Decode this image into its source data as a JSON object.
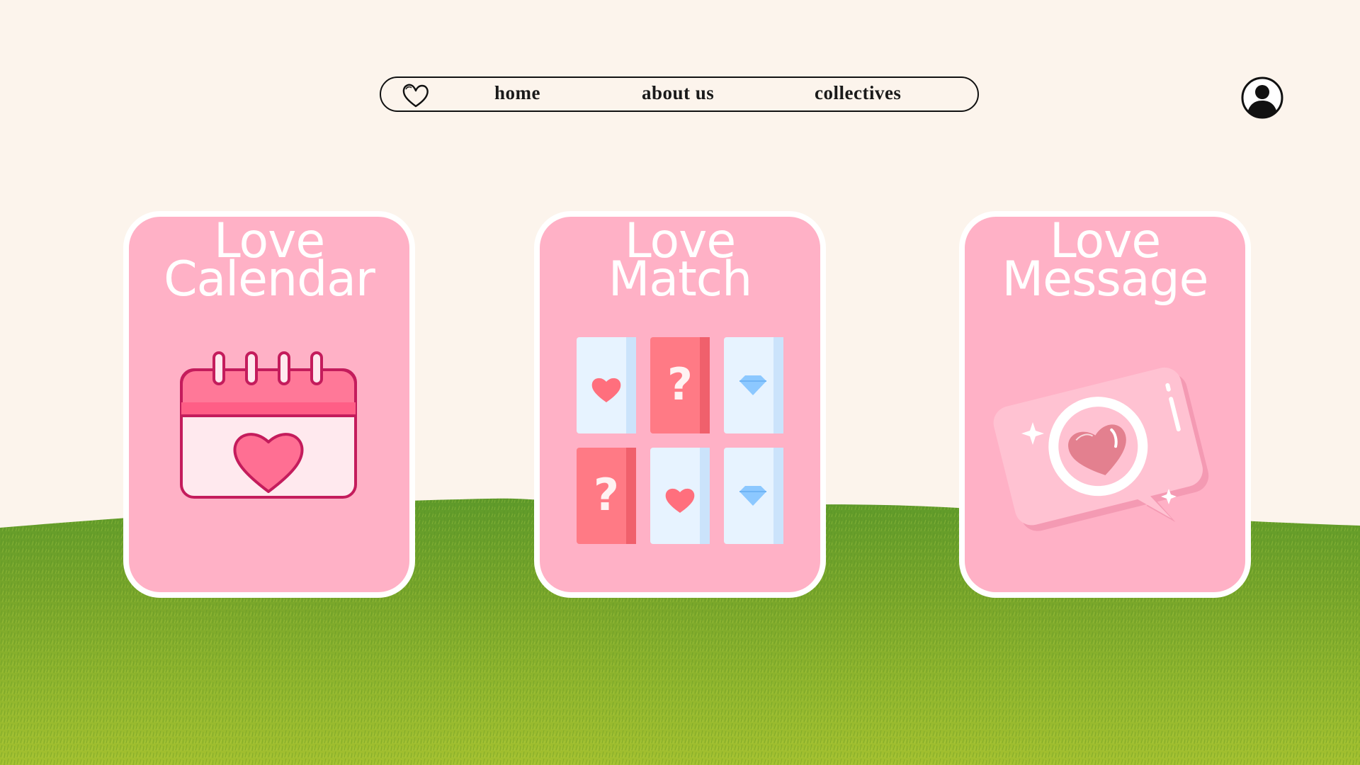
{
  "nav": {
    "logo_icon": "heart-outline-icon",
    "links": [
      {
        "label": "home"
      },
      {
        "label": "about us"
      },
      {
        "label": "collectives"
      }
    ]
  },
  "profile": {
    "icon": "user-avatar-icon"
  },
  "cards": [
    {
      "line1": "Love",
      "line2": "Calendar",
      "icon": "calendar-heart-icon"
    },
    {
      "line1": "Love",
      "line2": "Match",
      "icon": "memory-cards-icon"
    },
    {
      "line1": "Love",
      "line2": "Message",
      "icon": "heart-message-bubble-icon"
    }
  ],
  "colors": {
    "background": "#fcf4ec",
    "card": "#ffb1c6",
    "card_border": "#ffffff",
    "grass": "#86b02a",
    "accent_red": "#ff7a85",
    "accent_blue": "#8cc8ff"
  }
}
